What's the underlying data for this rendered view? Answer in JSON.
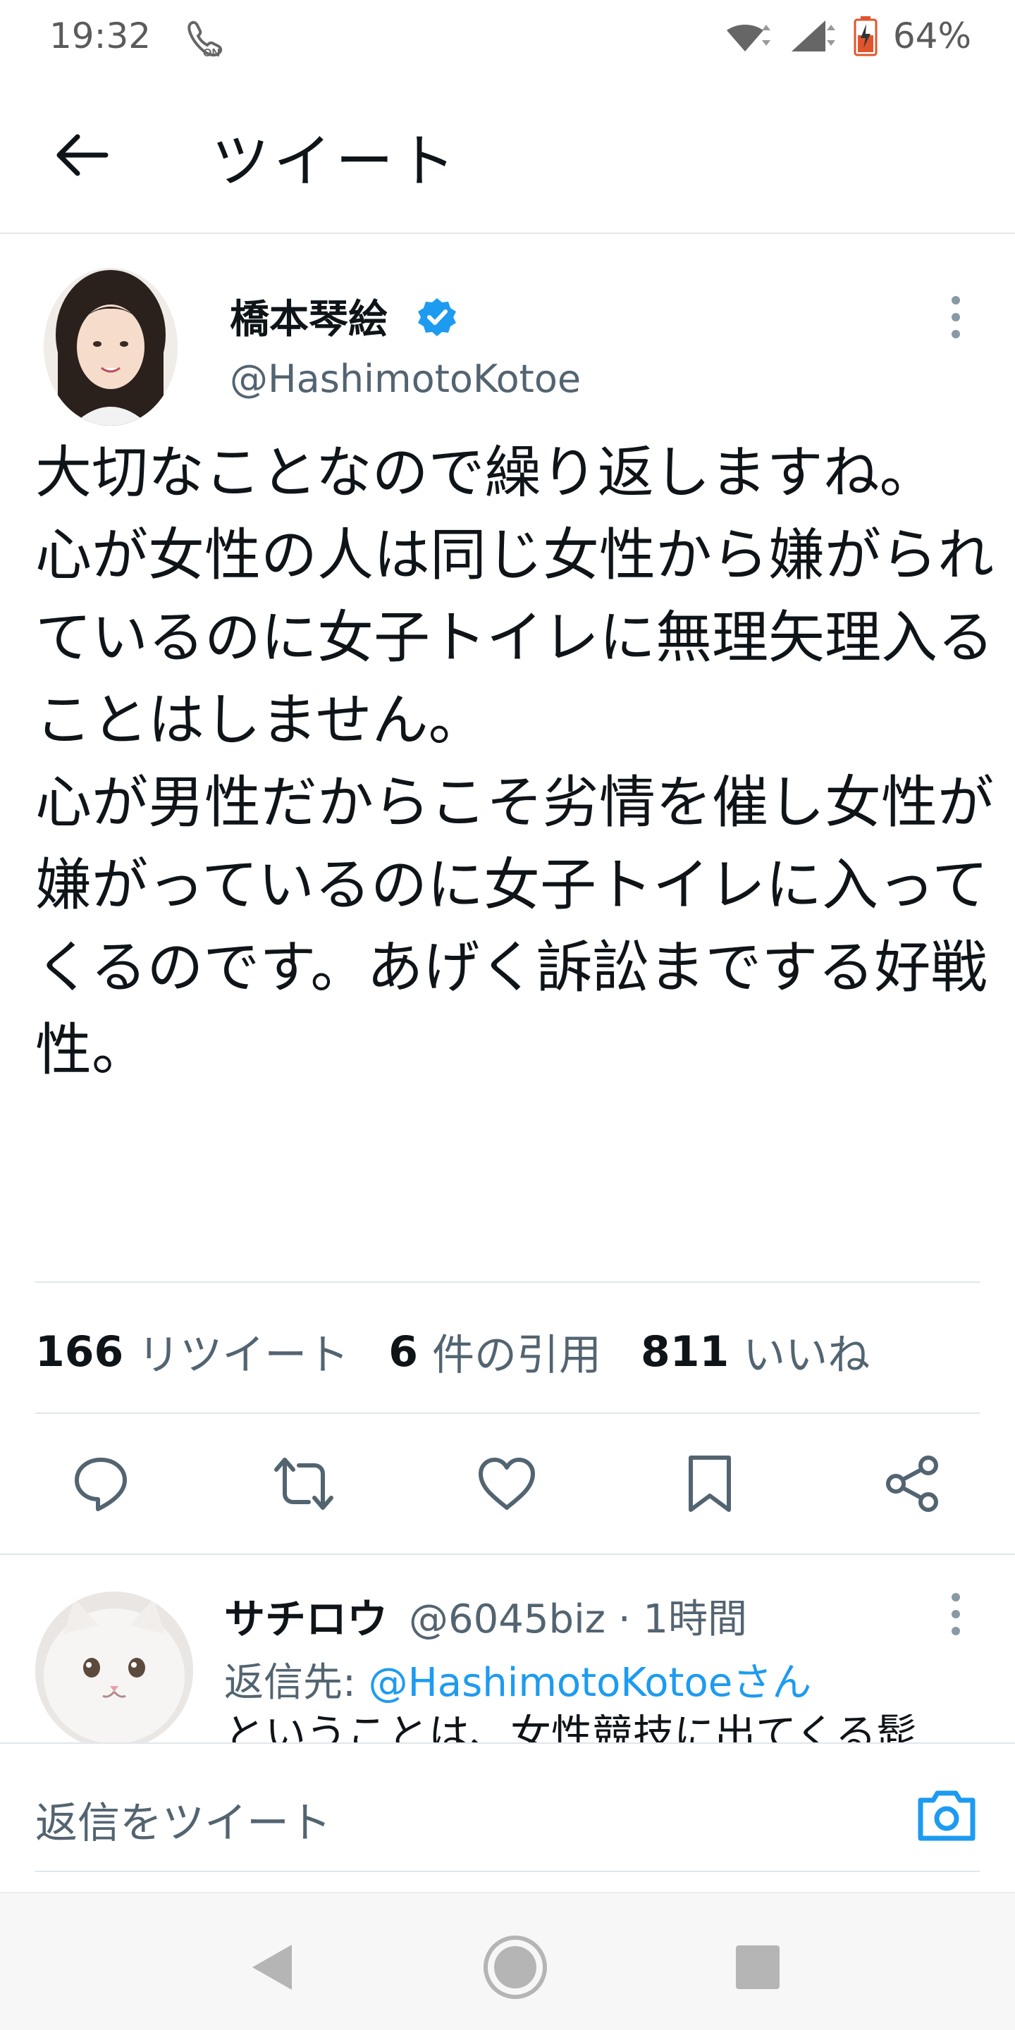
{
  "status_bar": {
    "time": "19:32",
    "battery": "64%",
    "call_badge": "ON"
  },
  "header": {
    "title": "ツイート"
  },
  "tweet": {
    "author_name": "橋本琴絵",
    "author_handle": "@HashimotoKotoe",
    "text": "大切なことなので繰り返しますね。\n心が女性の人は同じ女性から嫌がられているのに女子トイレに無理矢理入ることはしません。\n心が男性だからこそ劣情を催し女性が嫌がっているのに女子トイレに入ってくるのです。あげく訴訟までする好戦性。"
  },
  "stats": {
    "retweets_count": "166",
    "retweets_label": "リツイート",
    "quotes_count": "6",
    "quotes_label": "件の引用",
    "likes_count": "811",
    "likes_label": "いいね"
  },
  "reply": {
    "author_name": "サチロウ",
    "meta": "@6045biz · 1時間",
    "reply_to_prefix": "返信先: ",
    "reply_to_handle": "@HashimotoKotoeさん",
    "snippet": "ということは、女性競技に出てくる髭"
  },
  "composer": {
    "placeholder": "返信をツイート"
  },
  "colors": {
    "accent": "#1d9bf0",
    "text": "#0f1419",
    "muted": "#536471"
  }
}
